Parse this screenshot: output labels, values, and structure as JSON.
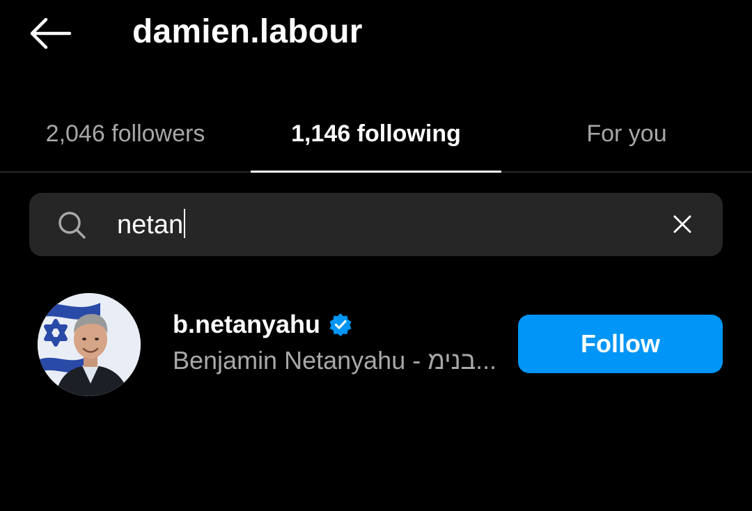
{
  "header": {
    "back_icon": "arrow-left-icon",
    "title": "damien.labour"
  },
  "tabs": [
    {
      "label": "2,046 followers",
      "active": false
    },
    {
      "label": "1,146 following",
      "active": true
    },
    {
      "label": "For you",
      "active": false
    }
  ],
  "search": {
    "icon": "search-icon",
    "value": "netan",
    "clear_icon": "close-icon"
  },
  "results": [
    {
      "username": "b.netanyahu",
      "verified": true,
      "full_name": "Benjamin Netanyahu - בנימ...",
      "button_label": "Follow"
    }
  ],
  "colors": {
    "background": "#000000",
    "search_bg": "#262626",
    "secondary_text": "#a8a8a8",
    "accent": "#0095f6",
    "verified_badge": "#0095f6"
  }
}
